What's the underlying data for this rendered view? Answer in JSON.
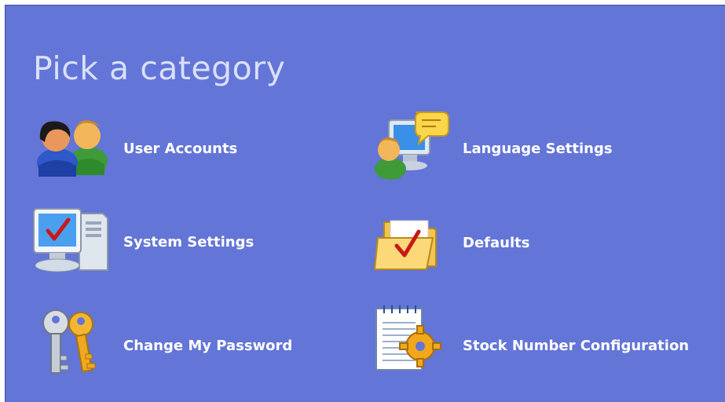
{
  "header": {
    "title": "Pick a category"
  },
  "categories": [
    {
      "label": "User Accounts",
      "icon": "user-accounts-icon"
    },
    {
      "label": "Language Settings",
      "icon": "language-settings-icon"
    },
    {
      "label": "System Settings",
      "icon": "system-settings-icon"
    },
    {
      "label": "Defaults",
      "icon": "defaults-folder-icon"
    },
    {
      "label": "Change My Password",
      "icon": "keys-icon"
    },
    {
      "label": "Stock Number Configuration",
      "icon": "notepad-gear-icon"
    }
  ],
  "colors": {
    "panel_bg": "#6375d6",
    "title": "#d9e0fa",
    "label": "#ffffff"
  }
}
